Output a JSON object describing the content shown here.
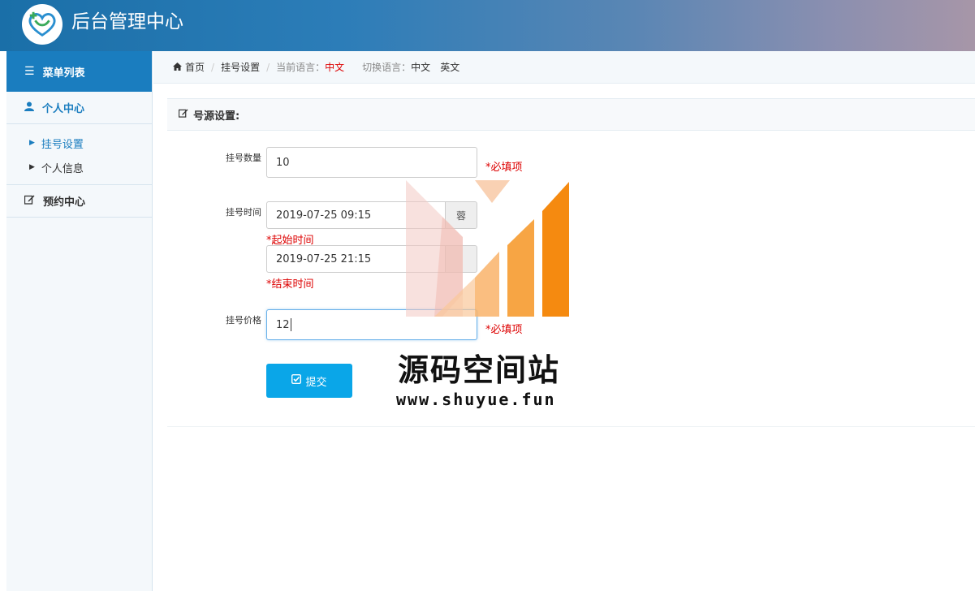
{
  "header": {
    "title": "后台管理中心",
    "logo_icon": "heart-cross-logo"
  },
  "sidebar": {
    "menu_title": "菜单列表",
    "sections": [
      {
        "label": "个人中心",
        "icon": "user-icon",
        "items": [
          {
            "label": "挂号设置",
            "active": true
          },
          {
            "label": "个人信息",
            "active": false
          }
        ]
      },
      {
        "label": "预约中心",
        "icon": "edit-icon"
      }
    ]
  },
  "breadcrumb": {
    "home": "首页",
    "current": "挂号设置",
    "lang_current_label": "当前语言：",
    "lang_current_value": "中文",
    "lang_switch_label": "切换语言：",
    "lang_options": [
      "中文",
      "英文"
    ]
  },
  "panel": {
    "title": "号源设置:",
    "fields": {
      "count": {
        "label": "挂号数量",
        "value": "10",
        "required_note": "*必填项"
      },
      "time": {
        "label": "挂号时间",
        "start_value": "2019-07-25 09:15",
        "start_hint": "*起始时间",
        "end_value": "2019-07-25 21:15",
        "end_hint": "*结束时间",
        "addon_icon": "calendar-icon",
        "addon_text": "蓉"
      },
      "price": {
        "label": "挂号价格",
        "value": "12",
        "required_note": "*必填项"
      }
    },
    "submit_label": "提交"
  },
  "watermark": {
    "text": "源码空间站",
    "url": "www.shuyue.fun"
  },
  "colors": {
    "accent": "#1a7dbf",
    "submit": "#0aa6e8",
    "required": "#dd0000"
  }
}
